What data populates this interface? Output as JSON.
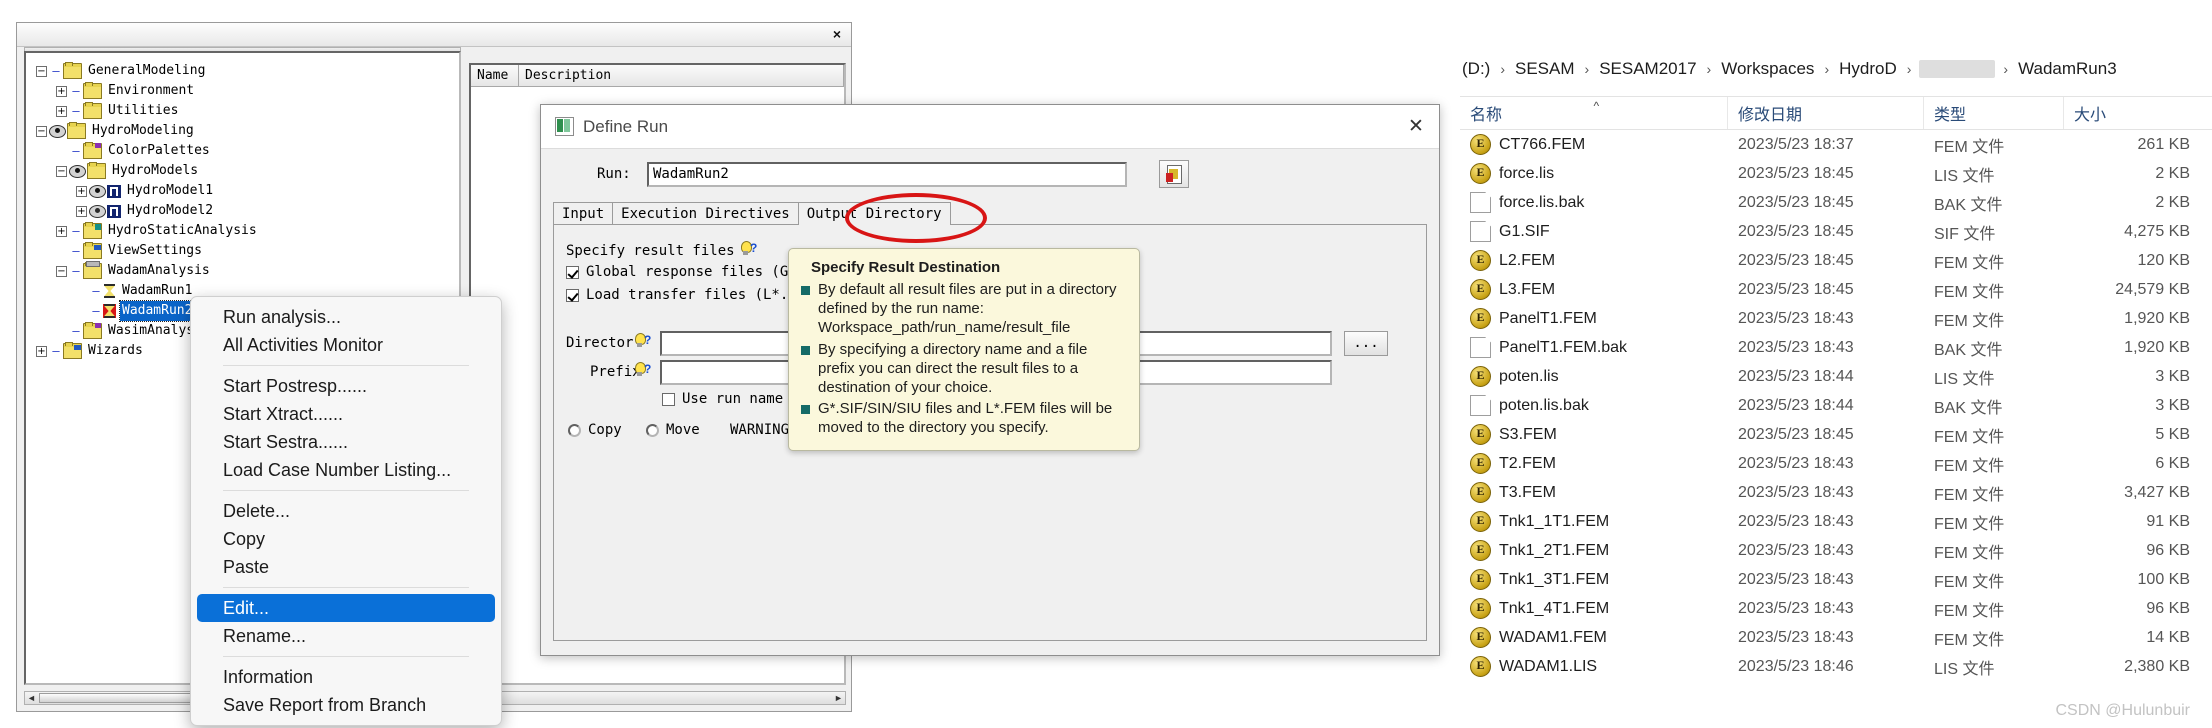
{
  "sesam_window": {
    "close_label": "×",
    "table_headers": [
      "Name",
      "Description"
    ],
    "tree": [
      {
        "indent": 0,
        "toggle": "minus",
        "icon": "folder",
        "label": "GeneralModeling",
        "selected": false
      },
      {
        "indent": 1,
        "toggle": "plus",
        "icon": "folder",
        "label": "Environment",
        "selected": false
      },
      {
        "indent": 1,
        "toggle": "plus",
        "icon": "folder",
        "label": "Utilities",
        "selected": false
      },
      {
        "indent": 0,
        "toggle": "minus",
        "icon": "eye-folder",
        "label": "HydroModeling",
        "selected": false
      },
      {
        "indent": 1,
        "toggle": "none",
        "icon": "folder-purple",
        "label": "ColorPalettes",
        "selected": false
      },
      {
        "indent": 1,
        "toggle": "minus",
        "icon": "eye-folder",
        "label": "HydroModels",
        "selected": false
      },
      {
        "indent": 2,
        "toggle": "plus",
        "icon": "eye-model",
        "label": "HydroModel1",
        "selected": false
      },
      {
        "indent": 2,
        "toggle": "plus",
        "icon": "eye-model-open",
        "label": "HydroModel2",
        "selected": false
      },
      {
        "indent": 1,
        "toggle": "plus",
        "icon": "folder-teal",
        "label": "HydroStaticAnalysis",
        "selected": false
      },
      {
        "indent": 1,
        "toggle": "none",
        "icon": "folder-blue",
        "label": "ViewSettings",
        "selected": false
      },
      {
        "indent": 1,
        "toggle": "minus",
        "icon": "folder-grey",
        "label": "WadamAnalysis",
        "selected": false
      },
      {
        "indent": 2,
        "toggle": "none",
        "icon": "hourglass",
        "label": "WadamRun1",
        "selected": false
      },
      {
        "indent": 2,
        "toggle": "none",
        "icon": "hourglass-error",
        "label": "WadamRun2",
        "selected": true
      },
      {
        "indent": 1,
        "toggle": "none",
        "icon": "folder-purple",
        "label": "WasimAnalysis",
        "selected": false
      },
      {
        "indent": 0,
        "toggle": "plus",
        "icon": "folder-wizard",
        "label": "Wizards",
        "selected": false
      }
    ]
  },
  "context_menu": {
    "items": [
      {
        "label": "Run analysis...",
        "highlighted": false,
        "separator_after": false
      },
      {
        "label": "All Activities Monitor",
        "highlighted": false,
        "separator_after": true
      },
      {
        "label": "Start Postresp......",
        "highlighted": false,
        "separator_after": false
      },
      {
        "label": "Start Xtract......",
        "highlighted": false,
        "separator_after": false
      },
      {
        "label": "Start Sestra......",
        "highlighted": false,
        "separator_after": false
      },
      {
        "label": "Load Case Number Listing...",
        "highlighted": false,
        "separator_after": true
      },
      {
        "label": "Delete...",
        "highlighted": false,
        "separator_after": false
      },
      {
        "label": "Copy",
        "highlighted": false,
        "separator_after": false
      },
      {
        "label": "Paste",
        "highlighted": false,
        "separator_after": true
      },
      {
        "label": "Edit...",
        "highlighted": true,
        "separator_after": false
      },
      {
        "label": "Rename...",
        "highlighted": false,
        "separator_after": true
      },
      {
        "label": "Information",
        "highlighted": false,
        "separator_after": false
      },
      {
        "label": "Save Report from Branch",
        "highlighted": false,
        "separator_after": false
      }
    ]
  },
  "define_run": {
    "title": "Define Run",
    "close_label": "✕",
    "run_label": "Run:",
    "run_value": "WadamRun2",
    "tabs": [
      {
        "label": "Input",
        "active": false
      },
      {
        "label": "Execution Directives",
        "active": false
      },
      {
        "label": "Output Directory",
        "active": true,
        "annotated": true
      }
    ],
    "specify_result_files_label": "Specify result files",
    "checkboxes": [
      {
        "label": "Global response files (G*.SIF/SIN/SIU)",
        "checked": true
      },
      {
        "label": "Load transfer files (L*.FEM)",
        "checked": true
      }
    ],
    "directory_label": "Director",
    "directory_value": "",
    "prefix_label": "Prefix",
    "prefix_value": "",
    "use_run_name_label": "Use run name as prefix",
    "use_run_name_checked": false,
    "copy_label": "Copy",
    "move_label": "Move",
    "warning_label": "WARNING: Existing files will be overwritten"
  },
  "tooltip": {
    "title": "Specify Result Destination",
    "bullets": [
      "By default all result files are put in a directory defined by the run name: Workspace_path/run_name/result_file",
      "By specifying a directory name and a file prefix you can direct the result files to a destination of your choice.",
      "G*.SIF/SIN/SIU files and L*.FEM files will be moved to the directory you specify."
    ]
  },
  "explorer": {
    "breadcrumb": [
      "(D:)",
      "SESAM",
      "SESAM2017",
      "Workspaces",
      "HydroD",
      "__REDACTED__",
      "WadamRun3"
    ],
    "separator": "›",
    "columns": [
      "名称",
      "修改日期",
      "类型",
      "大小"
    ],
    "sort_marker": "^",
    "files": [
      {
        "icon": "fem",
        "name": "CT766.FEM",
        "date": "2023/5/23 18:37",
        "type": "FEM 文件",
        "size": "261 KB"
      },
      {
        "icon": "fem",
        "name": "force.lis",
        "date": "2023/5/23 18:45",
        "type": "LIS 文件",
        "size": "2 KB"
      },
      {
        "icon": "doc",
        "name": "force.lis.bak",
        "date": "2023/5/23 18:45",
        "type": "BAK 文件",
        "size": "2 KB"
      },
      {
        "icon": "doc",
        "name": "G1.SIF",
        "date": "2023/5/23 18:45",
        "type": "SIF 文件",
        "size": "4,275 KB"
      },
      {
        "icon": "fem",
        "name": "L2.FEM",
        "date": "2023/5/23 18:45",
        "type": "FEM 文件",
        "size": "120 KB"
      },
      {
        "icon": "fem",
        "name": "L3.FEM",
        "date": "2023/5/23 18:45",
        "type": "FEM 文件",
        "size": "24,579 KB"
      },
      {
        "icon": "fem",
        "name": "PanelT1.FEM",
        "date": "2023/5/23 18:43",
        "type": "FEM 文件",
        "size": "1,920 KB"
      },
      {
        "icon": "doc",
        "name": "PanelT1.FEM.bak",
        "date": "2023/5/23 18:43",
        "type": "BAK 文件",
        "size": "1,920 KB"
      },
      {
        "icon": "fem",
        "name": "poten.lis",
        "date": "2023/5/23 18:44",
        "type": "LIS 文件",
        "size": "3 KB"
      },
      {
        "icon": "doc",
        "name": "poten.lis.bak",
        "date": "2023/5/23 18:44",
        "type": "BAK 文件",
        "size": "3 KB"
      },
      {
        "icon": "fem",
        "name": "S3.FEM",
        "date": "2023/5/23 18:45",
        "type": "FEM 文件",
        "size": "5 KB"
      },
      {
        "icon": "fem",
        "name": "T2.FEM",
        "date": "2023/5/23 18:43",
        "type": "FEM 文件",
        "size": "6 KB"
      },
      {
        "icon": "fem",
        "name": "T3.FEM",
        "date": "2023/5/23 18:43",
        "type": "FEM 文件",
        "size": "3,427 KB"
      },
      {
        "icon": "fem",
        "name": "Tnk1_1T1.FEM",
        "date": "2023/5/23 18:43",
        "type": "FEM 文件",
        "size": "91 KB"
      },
      {
        "icon": "fem",
        "name": "Tnk1_2T1.FEM",
        "date": "2023/5/23 18:43",
        "type": "FEM 文件",
        "size": "96 KB"
      },
      {
        "icon": "fem",
        "name": "Tnk1_3T1.FEM",
        "date": "2023/5/23 18:43",
        "type": "FEM 文件",
        "size": "100 KB"
      },
      {
        "icon": "fem",
        "name": "Tnk1_4T1.FEM",
        "date": "2023/5/23 18:43",
        "type": "FEM 文件",
        "size": "96 KB"
      },
      {
        "icon": "fem",
        "name": "WADAM1.FEM",
        "date": "2023/5/23 18:43",
        "type": "FEM 文件",
        "size": "14 KB"
      },
      {
        "icon": "fem",
        "name": "WADAM1.LIS",
        "date": "2023/5/23 18:46",
        "type": "LIS 文件",
        "size": "2,380 KB"
      }
    ]
  },
  "watermark": "CSDN @Hulunbuir"
}
